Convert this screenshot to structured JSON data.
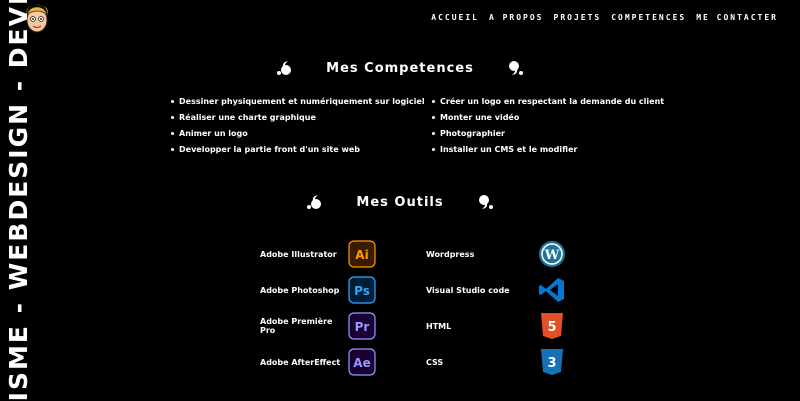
{
  "banner": {
    "vertical_text": "ISME - WEBDESIGN - DEVEL"
  },
  "nav": {
    "items": [
      "Accueil",
      "A propos",
      "Projets",
      "Competences",
      "Me contacter"
    ]
  },
  "competences": {
    "title": "Mes Competences",
    "items": [
      "Dessiner physiquement et numériquement sur logiciel",
      "Créer un logo en respectant la demande du client",
      "Réaliser une charte graphique",
      "Monter une vidéo",
      "Animer un logo",
      "Photographier",
      "Developper la partie front d'un site web",
      "Installer un CMS et le modifier"
    ]
  },
  "outils": {
    "title": "Mes Outils",
    "items": [
      {
        "label": "Adobe Illustrator",
        "icon": "illustrator-icon",
        "letters": "Ai",
        "color": "#ff9a00"
      },
      {
        "label": "Wordpress",
        "icon": "wordpress-icon",
        "letters": "W",
        "color": "#21759b"
      },
      {
        "label": "Adobe Photoshop",
        "icon": "photoshop-icon",
        "letters": "Ps",
        "color": "#31a8ff"
      },
      {
        "label": "Visual Studio code",
        "icon": "vscode-icon",
        "letters": "",
        "color": "#0078d4"
      },
      {
        "label": "Adobe Première Pro",
        "icon": "premiere-icon",
        "letters": "Pr",
        "color": "#9999ff"
      },
      {
        "label": "HTML",
        "icon": "html5-icon",
        "letters": "5",
        "color": "#e34f26"
      },
      {
        "label": "Adobe AfterEffect",
        "icon": "aftereffects-icon",
        "letters": "Ae",
        "color": "#9999ff"
      },
      {
        "label": "CSS",
        "icon": "css3-icon",
        "letters": "3",
        "color": "#1572b6"
      }
    ]
  }
}
